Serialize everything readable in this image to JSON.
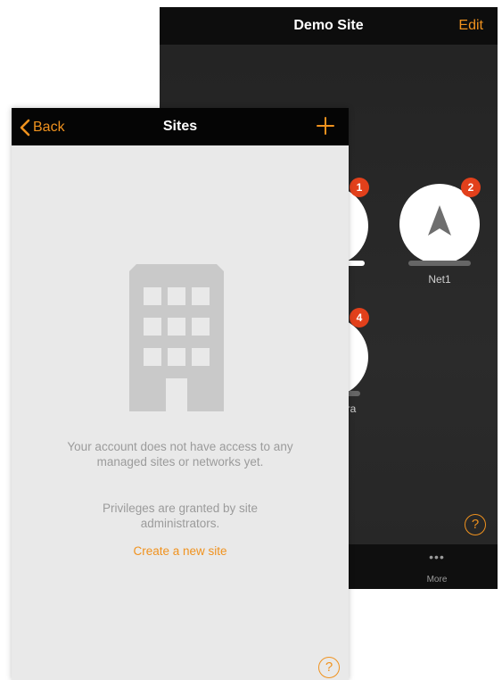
{
  "demo_site": {
    "title": "Demo Site",
    "edit_label": "Edit",
    "nodes": [
      {
        "badge": "1",
        "label": ""
      },
      {
        "badge": "2",
        "label": "Net1"
      },
      {
        "badge": "4",
        "label": "ra"
      }
    ],
    "help_label": "?",
    "tabbar": {
      "more_dots": "•••",
      "more_label": "More"
    }
  },
  "sites": {
    "back_label": "Back",
    "title": "Sites",
    "add_icon": "plus-icon",
    "empty_message": "Your account does not have access to any managed sites or networks yet.",
    "privileges_message": "Privileges are granted by site administrators.",
    "create_link": "Create a new site",
    "help_label": "?"
  },
  "colors": {
    "accent": "#f0921e",
    "badge": "#e2401b",
    "nav_bg": "#050505",
    "content_bg": "#e9e9e9",
    "dark_bg": "#262626"
  }
}
